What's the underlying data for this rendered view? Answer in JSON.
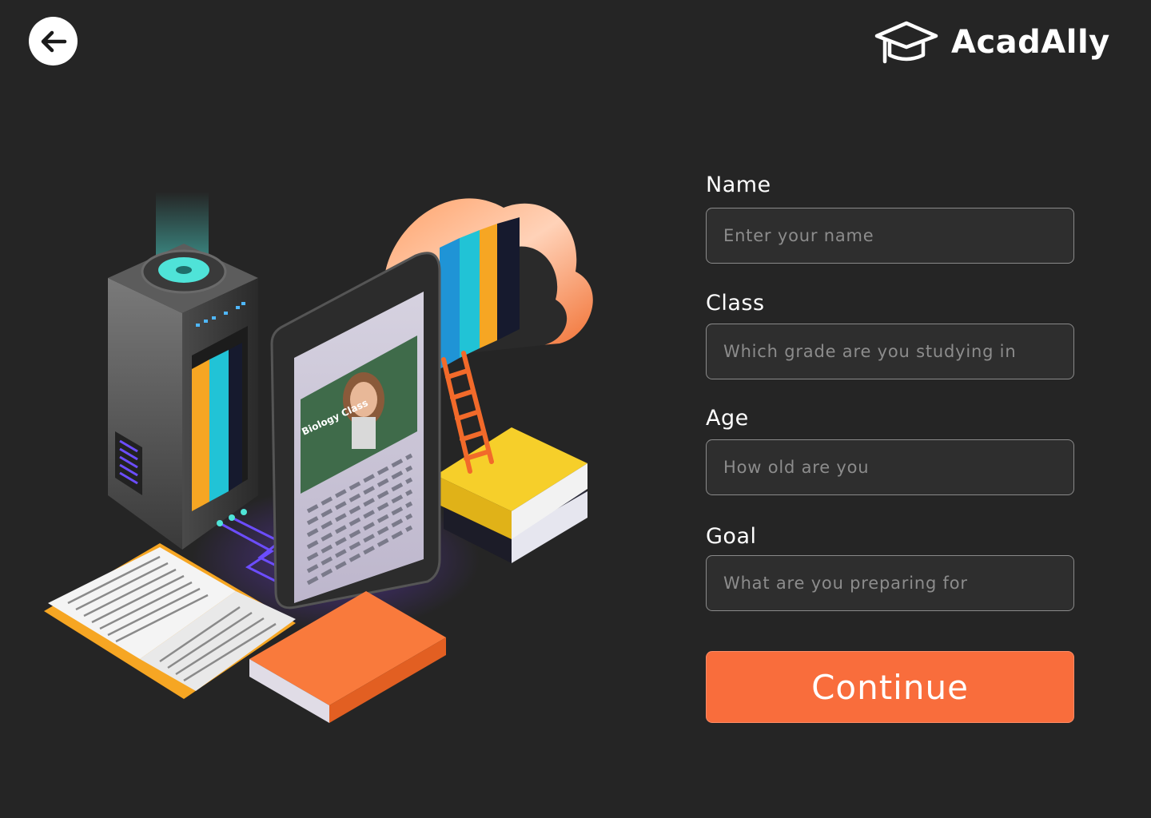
{
  "header": {
    "brand_name": "AcadAlly"
  },
  "illustration": {
    "tablet_video_title": "Biology Class"
  },
  "form": {
    "fields": [
      {
        "label": "Name",
        "placeholder": "Enter your name",
        "value": ""
      },
      {
        "label": "Class",
        "placeholder": "Which grade are you studying in",
        "value": ""
      },
      {
        "label": "Age",
        "placeholder": "How old are you",
        "value": ""
      },
      {
        "label": "Goal",
        "placeholder": "What are you preparing for",
        "value": ""
      }
    ],
    "continue_label": "Continue"
  },
  "colors": {
    "background": "#252525",
    "accent": "#f96d3c",
    "input_border": "#8a8a8a",
    "placeholder": "#8c8c8c"
  }
}
